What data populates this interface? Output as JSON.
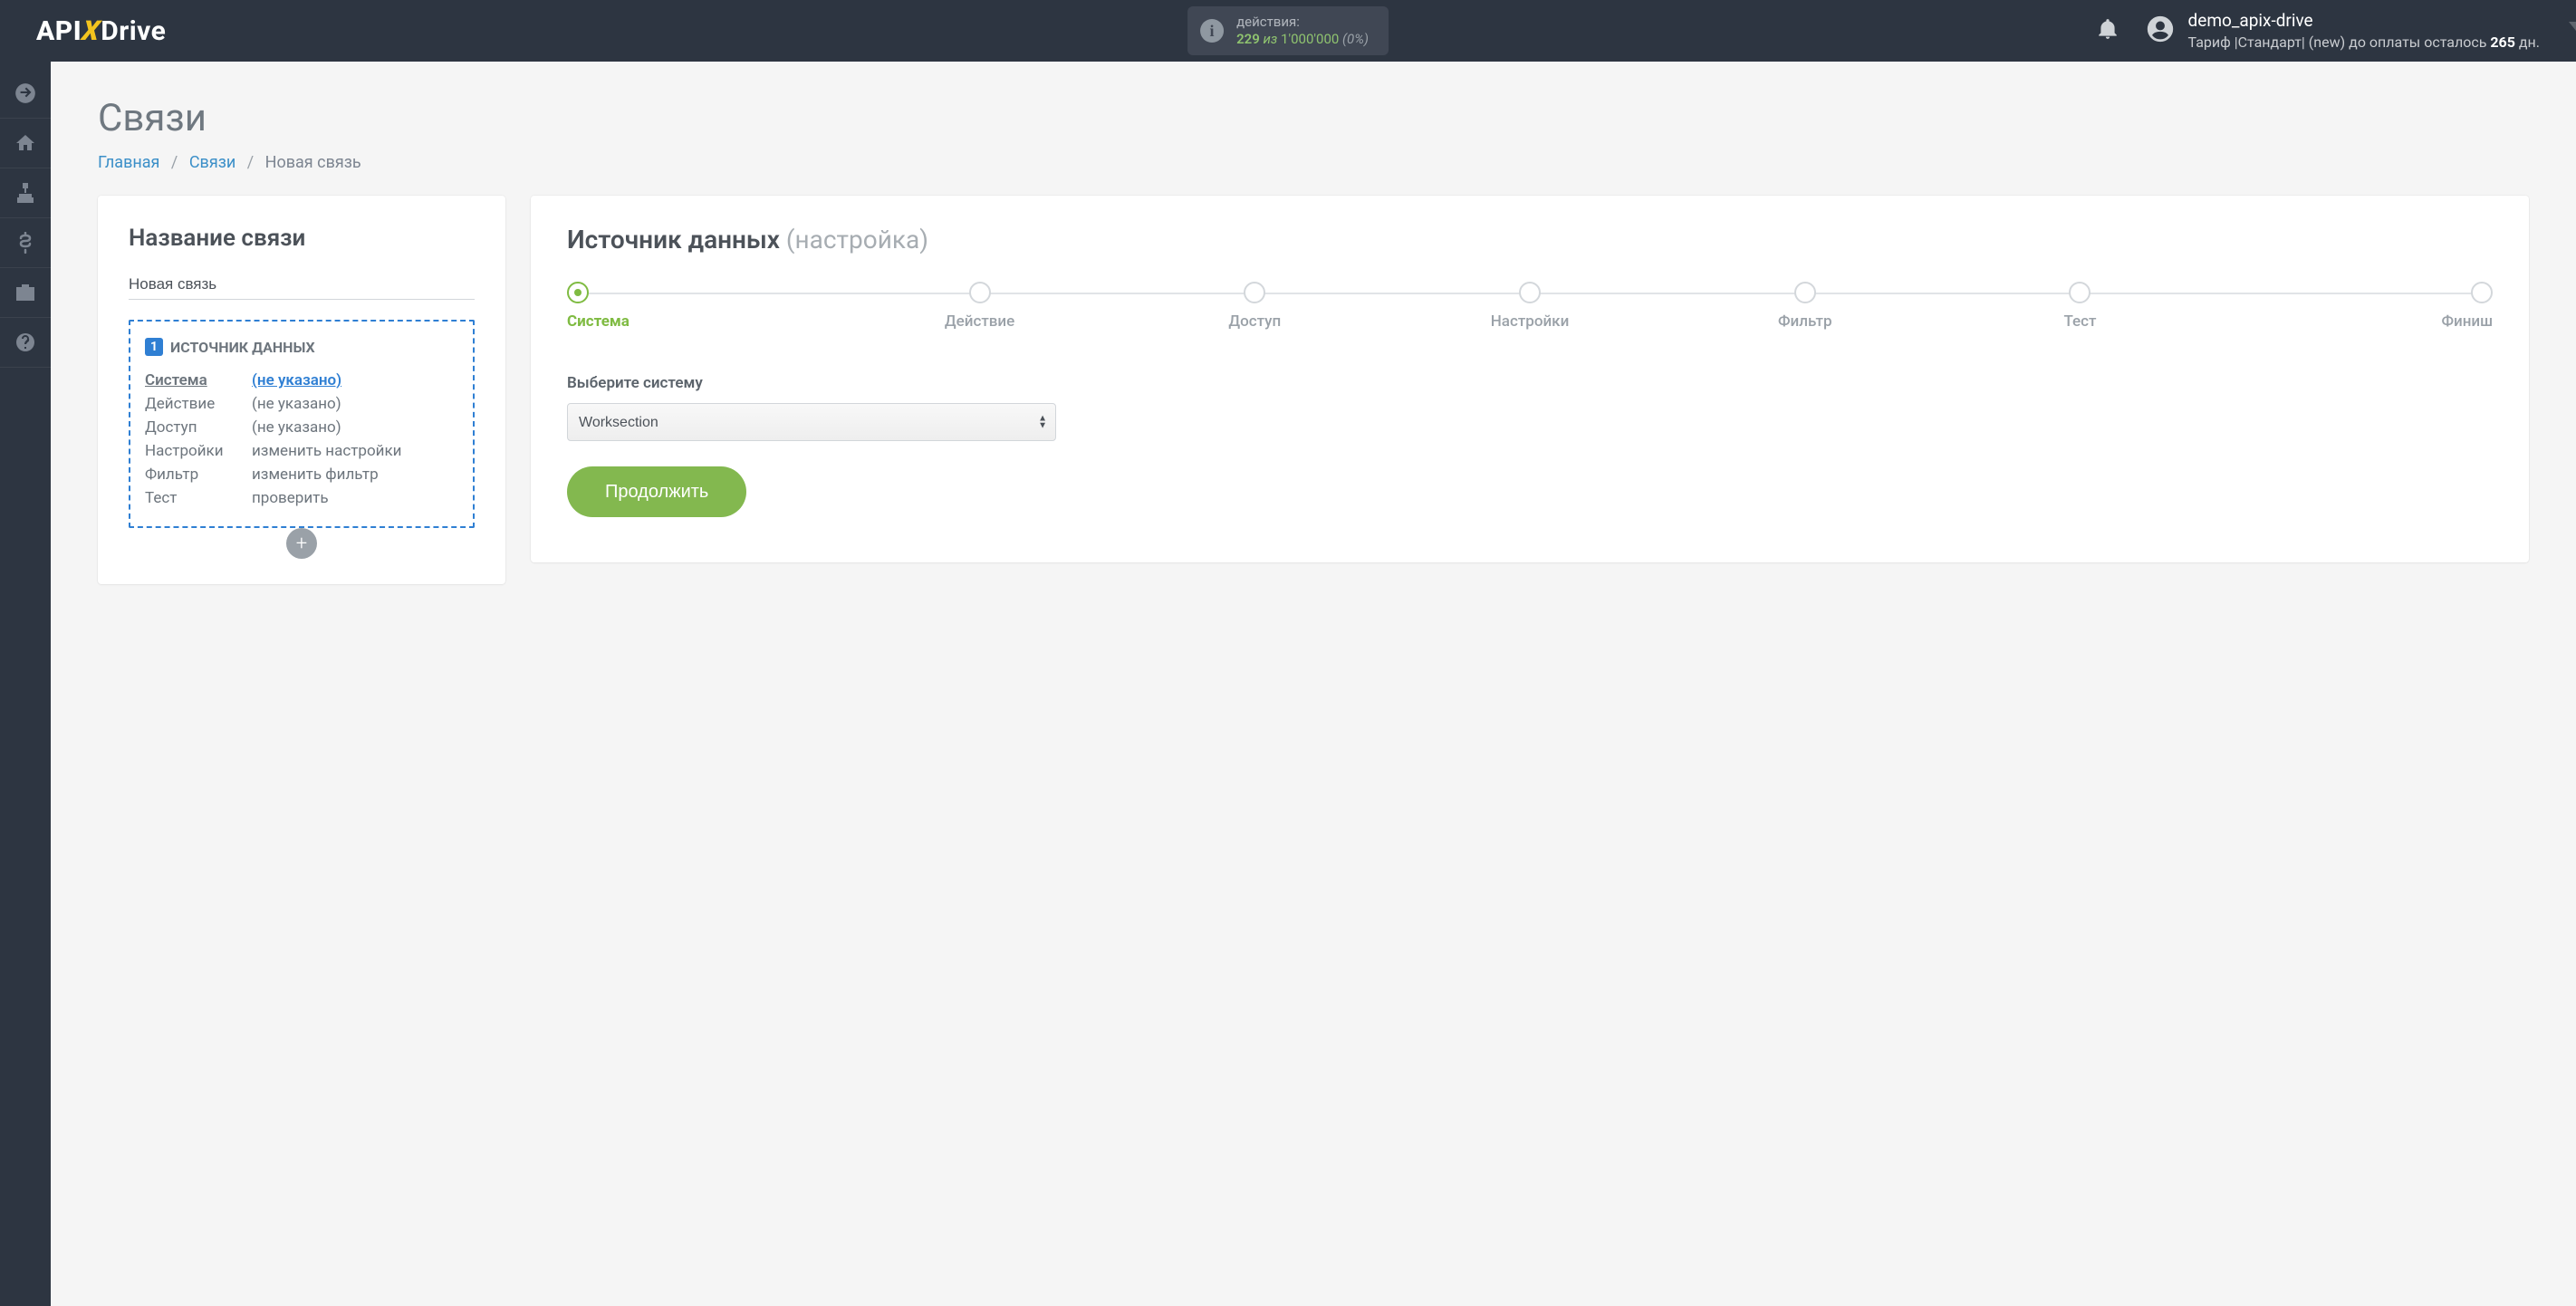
{
  "logo": {
    "a": "API",
    "x": "X",
    "drive": "Drive"
  },
  "header": {
    "actions_label": "действия:",
    "actions_count": "229",
    "actions_iz": "из",
    "actions_total": "1'000'000",
    "actions_pct": "(0%)",
    "username": "demo_apix-drive",
    "tariff_prefix": "Тариф |Стандарт| (new) до оплаты осталось ",
    "tariff_days": "265",
    "tariff_suffix": " дн."
  },
  "rail": [
    {
      "id": "arrow",
      "name": "enter-icon"
    },
    {
      "id": "home",
      "name": "home-icon"
    },
    {
      "id": "sitemap",
      "name": "connections-icon"
    },
    {
      "id": "dollar",
      "name": "billing-icon"
    },
    {
      "id": "briefcase",
      "name": "briefcase-icon"
    },
    {
      "id": "help",
      "name": "help-icon"
    }
  ],
  "page": {
    "title": "Связи",
    "crumb_home": "Главная",
    "crumb_links": "Связи",
    "crumb_current": "Новая связь"
  },
  "left": {
    "heading": "Название связи",
    "name_value": "Новая связь",
    "box_num": "1",
    "box_title": "ИСТОЧНИК ДАННЫХ",
    "rows": [
      {
        "k": "Система",
        "v": "(не указано)",
        "active": true
      },
      {
        "k": "Действие",
        "v": "(не указано)"
      },
      {
        "k": "Доступ",
        "v": "(не указано)"
      },
      {
        "k": "Настройки",
        "v": "изменить настройки"
      },
      {
        "k": "Фильтр",
        "v": "изменить фильтр"
      },
      {
        "k": "Тест",
        "v": "проверить"
      }
    ],
    "add": "+"
  },
  "right": {
    "heading_main": "Источник данных ",
    "heading_light": "(настройка)",
    "steps": [
      "Система",
      "Действие",
      "Доступ",
      "Настройки",
      "Фильтр",
      "Тест",
      "Финиш"
    ],
    "active_step": 0,
    "field_label": "Выберите систему",
    "select_value": "Worksection",
    "continue": "Продолжить"
  }
}
